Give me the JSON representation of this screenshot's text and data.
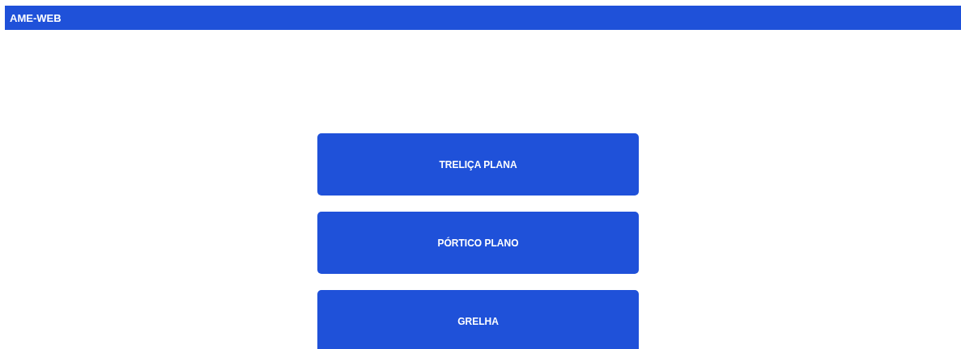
{
  "app_bar": {
    "title": "AME-WEB"
  },
  "buttons": [
    {
      "label": "TRELIÇA PLANA"
    },
    {
      "label": "PÓRTICO PLANO"
    },
    {
      "label": "GRELHA"
    }
  ]
}
